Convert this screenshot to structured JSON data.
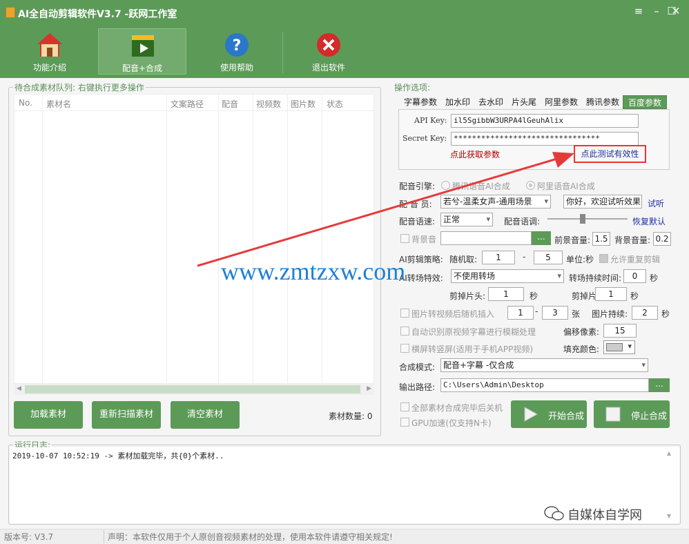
{
  "window": {
    "title": "AI全自动剪辑软件V3.7 -跃网工作室"
  },
  "toolbar": {
    "items": [
      {
        "label": "功能介绍",
        "icon": "home-icon"
      },
      {
        "label": "配音+合成",
        "icon": "clapperboard-icon"
      },
      {
        "label": "使用帮助",
        "icon": "help-icon"
      },
      {
        "label": "退出软件",
        "icon": "exit-icon"
      }
    ]
  },
  "queue": {
    "legend": "待合成素材队列: 右键执行更多操作",
    "columns": [
      "No.",
      "素材名",
      "文案路径",
      "配音",
      "视频数",
      "图片数",
      "状态"
    ],
    "buttons": {
      "load": "加载素材",
      "rescan": "重新扫描素材",
      "clear": "清空素材"
    },
    "count_label": "素材数量: 0"
  },
  "options": {
    "legend": "操作选项:",
    "tabs": [
      "字幕参数",
      "加水印",
      "去水印",
      "片头尾",
      "阿里参数",
      "腾讯参数",
      "百度参数"
    ],
    "api_key_label": "API Key:",
    "api_key_value": "il5SgibbW3URPA4lGeuhAlix",
    "secret_key_label": "Secret Key:",
    "secret_key_value": "********************************",
    "get_params_link": "点此获取参数",
    "test_link": "点此测试有效性",
    "engine_label": "配音引擎:",
    "engine_opt1": "腾讯语音AI合成",
    "engine_opt2": "阿里语音AI合成",
    "voice_label": "配 音 员:",
    "voice_value": "若兮-温柔女声-通用场景",
    "preview_text": "你好，欢迎试听效果",
    "preview_link": "试听",
    "speed_label": "配音语速:",
    "speed_value": "正常",
    "pitch_label": "配音语调:",
    "restore_link": "恢复默认",
    "bgm_label": "背景音",
    "bgm_browse": "...",
    "fg_vol_label": "前景音量:",
    "fg_vol": "1.5",
    "bg_vol_label": "背景音量:",
    "bg_vol": "0.2",
    "strategy_label": "AI剪辑策略:",
    "random_label": "随机取:",
    "random_from": "1",
    "random_dash": "-",
    "random_to": "5",
    "unit_label": "单位:秒",
    "allow_repeat": "允许重复剪辑",
    "transition_label": "AI转场特效:",
    "transition_value": "不使用转场",
    "transition_dur_label": "转场持续时间:",
    "transition_dur": "0",
    "sec": "秒",
    "cut_head_label": "剪掉片头:",
    "cut_head": "1",
    "cut_tail_label": "剪掉片尾:",
    "cut_tail": "1",
    "img_insert_label": "图片转视频后随机插入",
    "img_from": "1",
    "img_to": "3",
    "img_unit": "张",
    "img_dur_label": "图片持续:",
    "img_dur": "2",
    "blur_label": "自动识别原视频字幕进行模糊处理",
    "offset_label": "偏移像素:",
    "offset": "15",
    "landscape_label": "横屏转竖屏(适用于手机APP视频)",
    "fill_label": "填充颜色:",
    "mode_label": "合成模式:",
    "mode_value": "配音+字幕 -仅合成",
    "output_label": "输出路径:",
    "output_value": "C:\\Users\\Admin\\Desktop",
    "output_browse": "...",
    "shutdown_label": "全部素材合成完毕后关机",
    "gpu_label": "GPU加速(仅支持N卡)",
    "start_btn": "开始合成",
    "stop_btn": "停止合成"
  },
  "log": {
    "legend": "运行日志:",
    "line": "2019-10-07 10:52:19 -> 素材加载完毕，共{0}个素材.."
  },
  "status": {
    "version": "版本号: V3.7",
    "notice": "声明：本软件仅用于个人原创音视频素材的处理，使用本软件请遵守相关规定!"
  },
  "overlay": {
    "watermark": "www.zmtzxw.com",
    "badge": "自媒体自学网"
  },
  "colors": {
    "accent": "#5c9a58",
    "link_red": "#b00000",
    "link_blue": "#1c2fa0",
    "arrow": "#e53a3a"
  }
}
